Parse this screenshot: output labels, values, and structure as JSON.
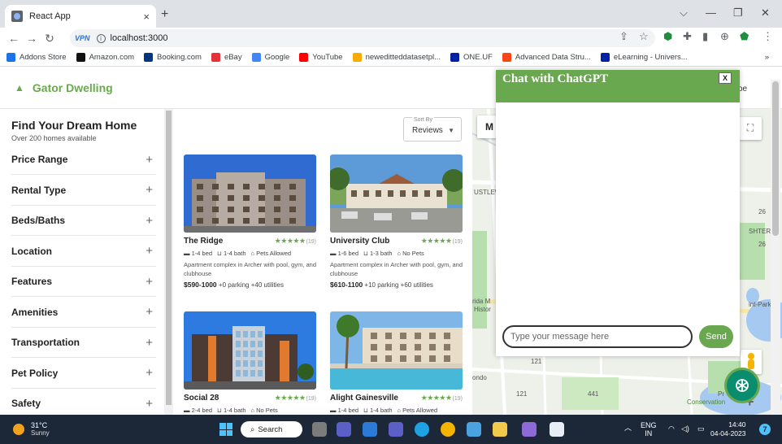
{
  "browser": {
    "tab_title": "React App",
    "tab_close": "×",
    "new_tab": "+",
    "window_controls": [
      "⌵",
      "—",
      "❐",
      "✕"
    ],
    "url": "localhost:3000",
    "vpn_badge": "VPN",
    "bookmarks": [
      {
        "label": "Addons Store",
        "icon_color": "#1a73e8",
        "icon_char": "◉"
      },
      {
        "label": "Amazon.com",
        "icon_color": "#111111",
        "icon_char": "a"
      },
      {
        "label": "Booking.com",
        "icon_color": "#003580",
        "icon_char": "B"
      },
      {
        "label": "eBay",
        "icon_color": "#e53238",
        "icon_char": "e"
      },
      {
        "label": "Google",
        "icon_color": "#4285f4",
        "icon_char": "G"
      },
      {
        "label": "YouTube",
        "icon_color": "#ff0000",
        "icon_char": "▶"
      },
      {
        "label": "neweditteddatasetpl...",
        "icon_color": "#f9ab00",
        "icon_char": "co"
      },
      {
        "label": "ONE.UF",
        "icon_color": "#0021a5",
        "icon_char": "UF"
      },
      {
        "label": "Advanced Data Stru...",
        "icon_color": "#fa4616",
        "icon_char": "UF"
      },
      {
        "label": "eLearning - Univers...",
        "icon_color": "#0021a5",
        "icon_char": "UF"
      }
    ],
    "bookmarks_more": "»"
  },
  "app": {
    "brand": "Gator Dwelling",
    "header_right_text": "oe",
    "sidebar": {
      "title": "Find Your Dream Home",
      "subtitle": "Over 200 homes available",
      "filters": [
        "Price Range",
        "Rental Type",
        "Beds/Baths",
        "Location",
        "Features",
        "Amenities",
        "Transportation",
        "Pet Policy",
        "Safety"
      ]
    },
    "sort": {
      "label": "Sort By",
      "value": "Reviews"
    },
    "listings": [
      {
        "name": "The Ridge",
        "stars": "★★★★★",
        "count": "(19)",
        "beds": "1-4 bed",
        "baths": "1-4 bath",
        "pets": "Pets Allowed",
        "desc": "Apartment complex in Archer with pool, gym, and clubhouse",
        "price": "$590-1000",
        "extras": "+0 parking  +40 utilities",
        "img": "ridge"
      },
      {
        "name": "University Club",
        "stars": "★★★★★",
        "count": "(19)",
        "beds": "1-6 bed",
        "baths": "1-3 bath",
        "pets": "No Pets",
        "desc": "Apartment complex in Archer with pool, gym, and clubhouse",
        "price": "$610-1100",
        "extras": "+10 parking  +60 utilities",
        "img": "club"
      },
      {
        "name": "Social 28",
        "stars": "★★★★★",
        "count": "(19)",
        "beds": "2-4 bed",
        "baths": "1-4 bath",
        "pets": "No Pets",
        "desc": "",
        "price": "",
        "extras": "",
        "img": "social"
      },
      {
        "name": "Alight Gainesville",
        "stars": "★★★★★",
        "count": "(19)",
        "beds": "1-4 bed",
        "baths": "1-4 bath",
        "pets": "Pets Allowed",
        "desc": "",
        "price": "",
        "extras": "",
        "img": "alight"
      }
    ],
    "map": {
      "button": "M",
      "labels": [
        "USTLEW",
        "rida M",
        "Histor",
        "ondo",
        "int-Park",
        "SHTER",
        "Conservation",
        "Pr",
        "121",
        "441",
        "121",
        "26",
        "26"
      ]
    },
    "chat": {
      "title": "Chat with ChatGPT",
      "close": "X",
      "placeholder": "Type your message here",
      "send": "Send"
    }
  },
  "taskbar": {
    "temp": "31°C",
    "condition": "Sunny",
    "search": "Search",
    "lang_top": "ENG",
    "lang_bottom": "IN",
    "time": "14:40",
    "date": "04-04-2023",
    "notifications": "7"
  },
  "colors": {
    "accent": "#6aa84f",
    "taskbar": "#1c2738"
  }
}
